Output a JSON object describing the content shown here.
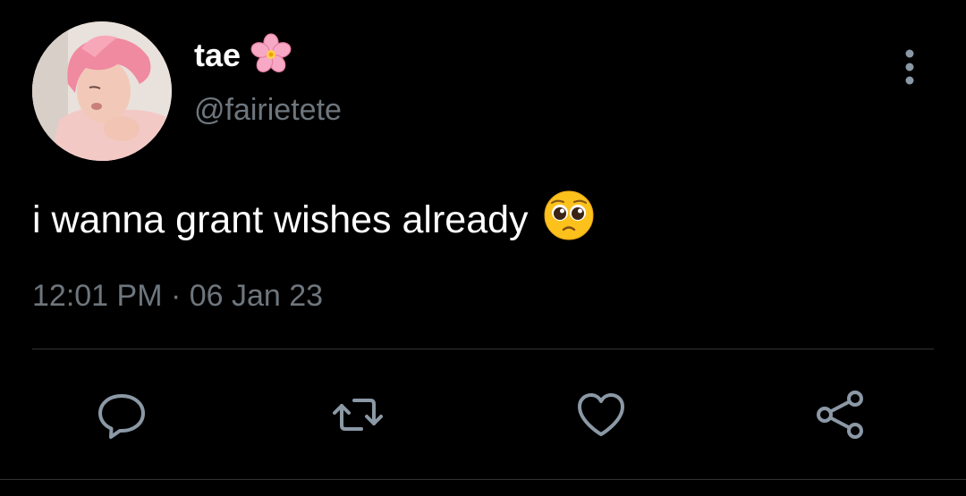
{
  "tweet": {
    "author": {
      "display_name": "tae",
      "name_emoji": "cherry-blossom",
      "handle": "@fairietete",
      "avatar": "avatar"
    },
    "text": "i wanna grant wishes already",
    "text_emoji": "pleading-face",
    "timestamp": "12:01 PM · 06 Jan 23",
    "actions": [
      {
        "name": "reply",
        "icon": "reply-icon"
      },
      {
        "name": "retweet",
        "icon": "retweet-icon"
      },
      {
        "name": "like",
        "icon": "heart-icon"
      },
      {
        "name": "share",
        "icon": "share-icon"
      }
    ],
    "menu_icon": "more-vertical-icon"
  },
  "colors": {
    "background": "#000000",
    "primary_text": "#ffffff",
    "secondary_text": "#6e767d",
    "divider": "#2f3336",
    "icon": "#8b98a5"
  }
}
